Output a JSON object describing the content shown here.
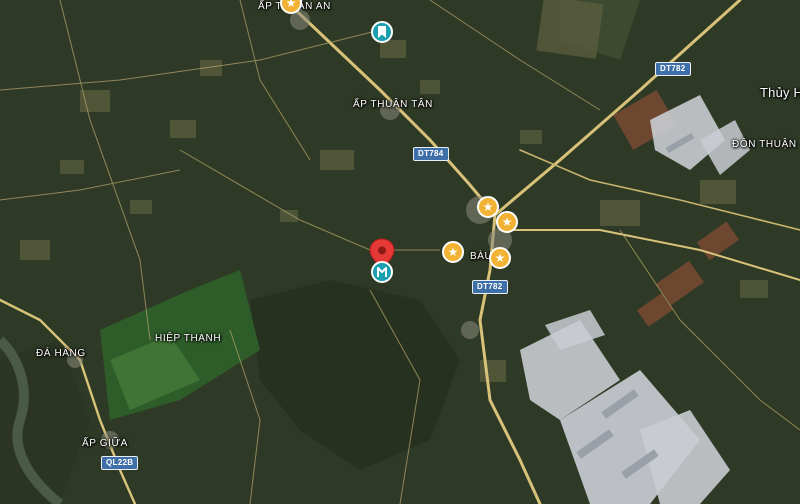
{
  "map": {
    "view": "satellite",
    "colors": {
      "vegetation": "#2f3a26",
      "field_light": "#6a6a4a",
      "industrial": "#c9ccd2",
      "road": "#d8c27a",
      "star_marker": "#f2b233",
      "saved_marker": "#1a9fb0",
      "pin": "#e53935"
    },
    "labels": [
      {
        "text": "ẤP THUẬN AN"
      },
      {
        "text": "ẤP THUẬN TÂN"
      },
      {
        "text": "Thủy H"
      },
      {
        "text": "ĐÔN THUẬN"
      },
      {
        "text": "BÀU"
      },
      {
        "text": "HIỆP THẠNH"
      },
      {
        "text": "ĐÁ HÀNG"
      },
      {
        "text": "ẤP GIỮA"
      }
    ],
    "road_shields": [
      {
        "text": "DT782"
      },
      {
        "text": "DT784"
      },
      {
        "text": "DT782"
      },
      {
        "text": "QL22B"
      }
    ],
    "markers": [
      {
        "type": "star",
        "icon": "star-icon"
      },
      {
        "type": "saved",
        "icon": "bookmark-icon"
      },
      {
        "type": "star",
        "icon": "star-icon"
      },
      {
        "type": "star",
        "icon": "star-icon"
      },
      {
        "type": "star",
        "icon": "star-icon"
      },
      {
        "type": "star",
        "icon": "star-icon"
      },
      {
        "type": "selected-location",
        "icon": "map-pin-icon"
      }
    ]
  }
}
